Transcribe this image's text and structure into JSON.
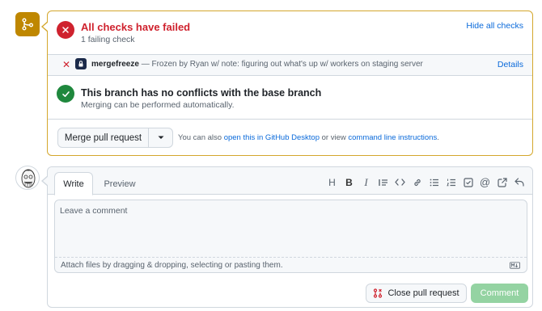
{
  "merge_status": {
    "checks": {
      "title": "All checks have failed",
      "subtitle": "1 failing check",
      "hide_label": "Hide all checks"
    },
    "check_row": {
      "app_name": "mergefreeze",
      "description": " — Frozen by Ryan w/ note: figuring out what's up w/ workers on staging server",
      "details_label": "Details"
    },
    "conflicts": {
      "title": "This branch has no conflicts with the base branch",
      "subtitle": "Merging can be performed automatically."
    },
    "merge_button_label": "Merge pull request",
    "hint": {
      "prefix": "You can also ",
      "desktop_link": "open this in GitHub Desktop",
      "middle": " or view ",
      "cli_link": "command line instructions",
      "suffix": "."
    }
  },
  "comment": {
    "tabs": [
      "Write",
      "Preview"
    ],
    "toolbar_icons": [
      "heading-icon",
      "bold-icon",
      "italic-icon",
      "quote-icon",
      "code-icon",
      "link-icon",
      "unordered-list-icon",
      "ordered-list-icon",
      "task-list-icon",
      "mention-icon",
      "reference-icon",
      "reply-icon"
    ],
    "placeholder": "Leave a comment",
    "attach_text": "Attach files by dragging & dropping, selecting or pasting them.",
    "close_label": "Close pull request",
    "comment_label": "Comment"
  },
  "colors": {
    "warning": "#bf8700",
    "danger": "#cf222e",
    "success": "#1f883d",
    "link": "#0969da",
    "comment_button_disabled": "#94d3a2"
  }
}
